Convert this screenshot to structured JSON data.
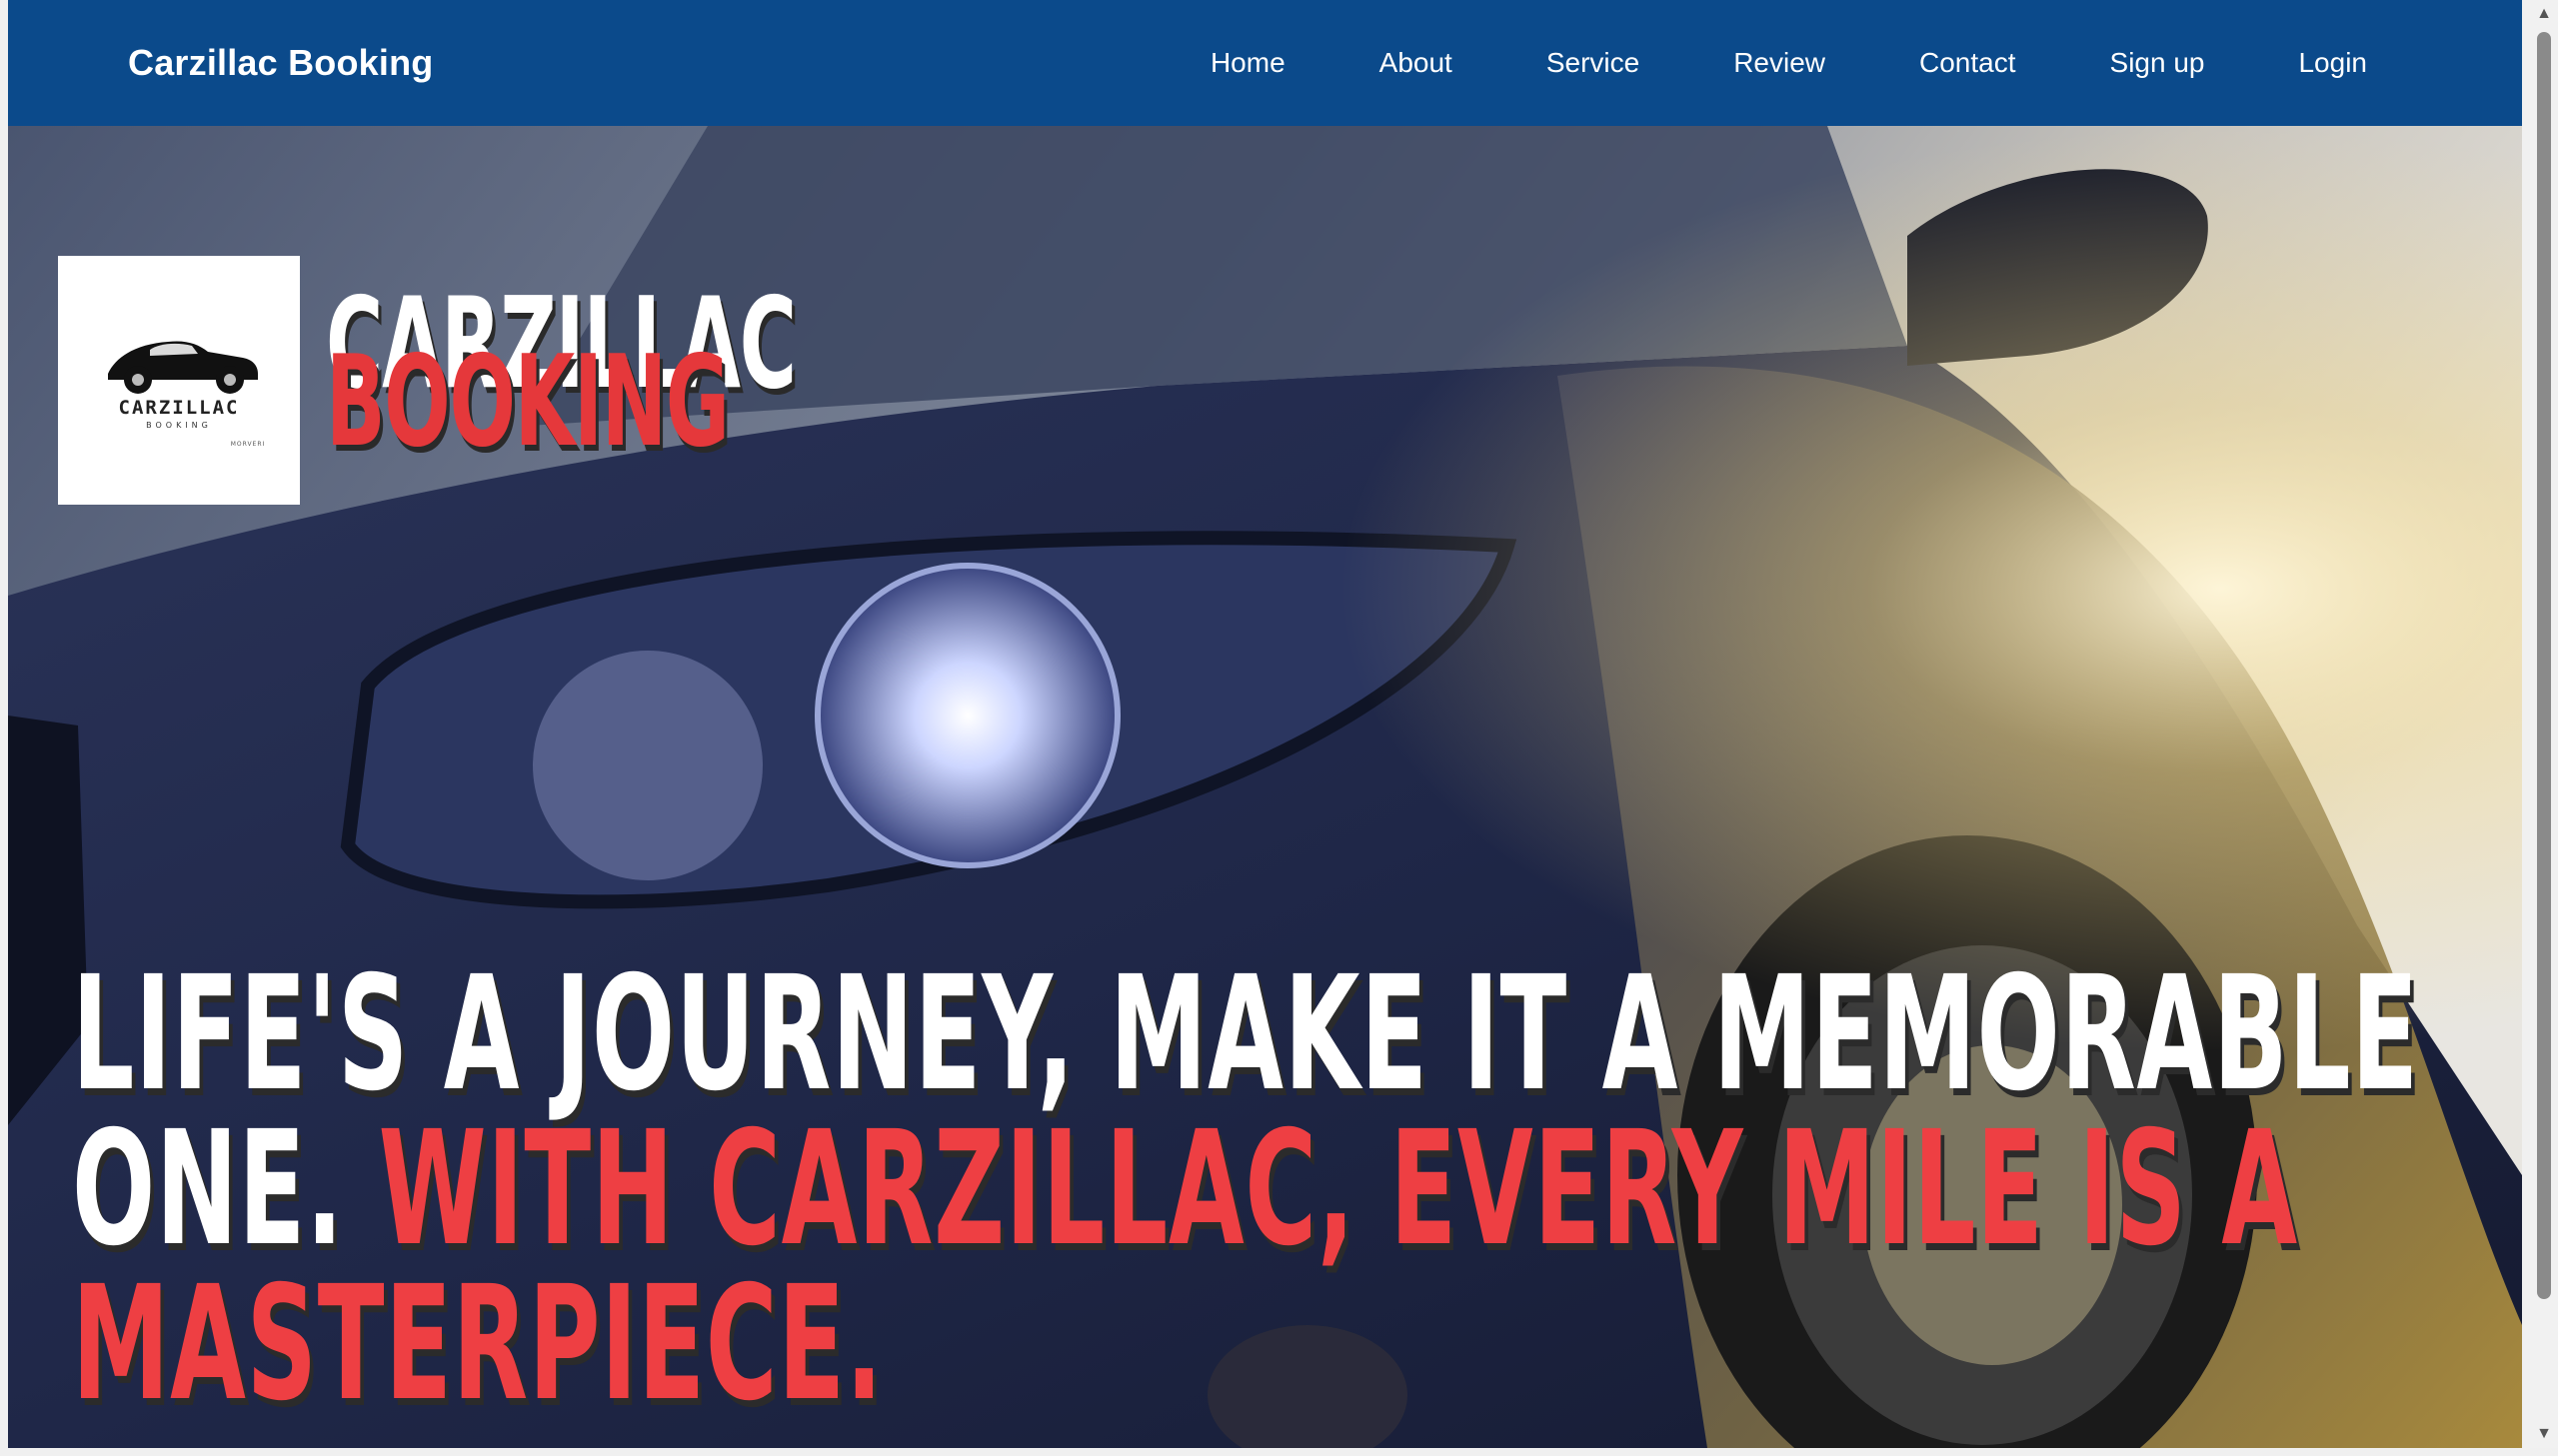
{
  "navbar": {
    "brand": "Carzillac Booking",
    "links": [
      {
        "label": "Home"
      },
      {
        "label": "About"
      },
      {
        "label": "Service"
      },
      {
        "label": "Review"
      },
      {
        "label": "Contact"
      },
      {
        "label": "Sign up"
      },
      {
        "label": "Login"
      }
    ]
  },
  "hero": {
    "logo_image": {
      "wordmark": "CARZILLAC",
      "sub": "BOOKING",
      "signature": "MORVERI"
    },
    "title_line1": "CARZILLAC",
    "title_line2": "BOOKING",
    "tagline_white_1": "LIFE'S A JOURNEY, MAKE IT A MEMORABLE",
    "tagline_white_2": "ONE. ",
    "tagline_red_1": "WITH CARZILLAC, EVERY MILE IS A",
    "tagline_red_2": "MASTERPIECE."
  },
  "colors": {
    "nav_bg": "#0b4a8b",
    "accent_red": "#ee3f43",
    "text_white": "#ffffff"
  },
  "scrollbar": {
    "up_icon": "chevron-up-icon",
    "down_icon": "chevron-down-icon"
  }
}
